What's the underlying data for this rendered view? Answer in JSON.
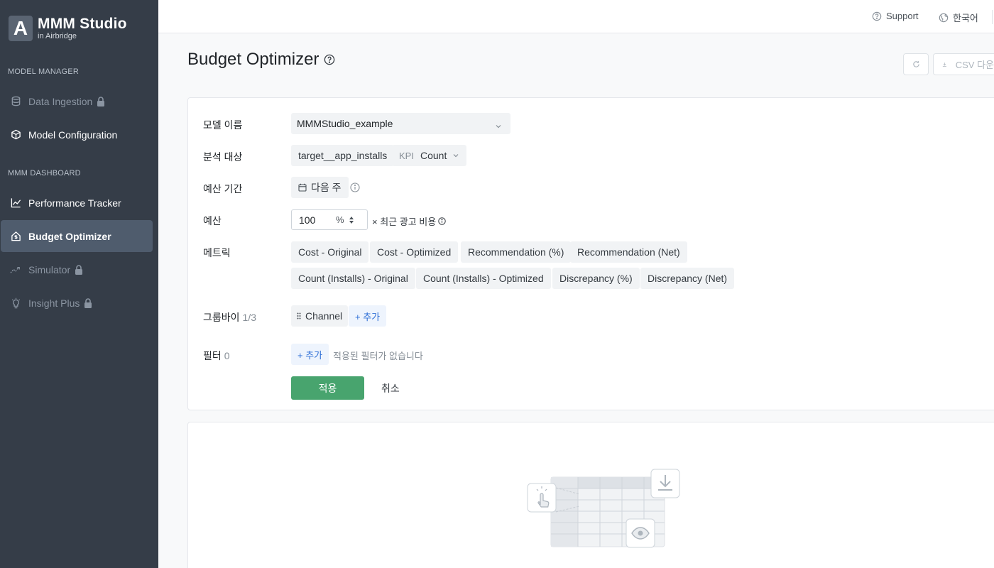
{
  "sidebar": {
    "logo_letter": "A",
    "logo_title": "MMM Studio",
    "logo_subtitle": "in Airbridge",
    "section_model_manager": "MODEL MANAGER",
    "section_mmm_dashboard": "MMM DASHBOARD",
    "items": [
      {
        "label": "Data Ingestion",
        "icon": "database-icon",
        "locked": true
      },
      {
        "label": "Model Configuration",
        "icon": "cube-icon",
        "locked": false
      },
      {
        "label": "Performance Tracker",
        "icon": "line-chart-icon",
        "locked": false
      },
      {
        "label": "Budget Optimizer",
        "icon": "home-dollar-icon",
        "locked": false,
        "active": true
      },
      {
        "label": "Simulator",
        "icon": "trend-icon",
        "locked": true
      },
      {
        "label": "Insight Plus",
        "icon": "lightbulb-icon",
        "locked": true
      }
    ]
  },
  "topbar": {
    "support_label": "Support",
    "language_label": "한국어"
  },
  "page": {
    "title": "Budget Optimizer",
    "csv_label": "CSV 다운"
  },
  "form": {
    "model_name_label": "모델 이름",
    "model_name_value": "MMMStudio_example",
    "target_label": "분석 대상",
    "target_value": "target__app_installs",
    "kpi_prefix": "KPI",
    "kpi_value": "Count",
    "period_label": "예산 기간",
    "period_value": "다음 주",
    "budget_label": "예산",
    "budget_value": "100",
    "budget_unit": "%",
    "budget_suffix": "× 최근 광고 비용",
    "metrics_label": "메트릭",
    "metrics": [
      "Cost - Original",
      "Cost - Optimized",
      "Recommendation (%)",
      "Recommendation (Net)",
      "Count (Installs) - Original",
      "Count (Installs) - Optimized",
      "Discrepancy (%)",
      "Discrepancy (Net)"
    ],
    "groupby_label": "그룹바이",
    "groupby_count": "1/3",
    "groupby_chip": "Channel",
    "add_label": "+ 추가",
    "filter_label": "필터",
    "filter_count": "0",
    "filter_empty": "적용된 필터가 없습니다",
    "apply_label": "적용",
    "cancel_label": "취소"
  }
}
